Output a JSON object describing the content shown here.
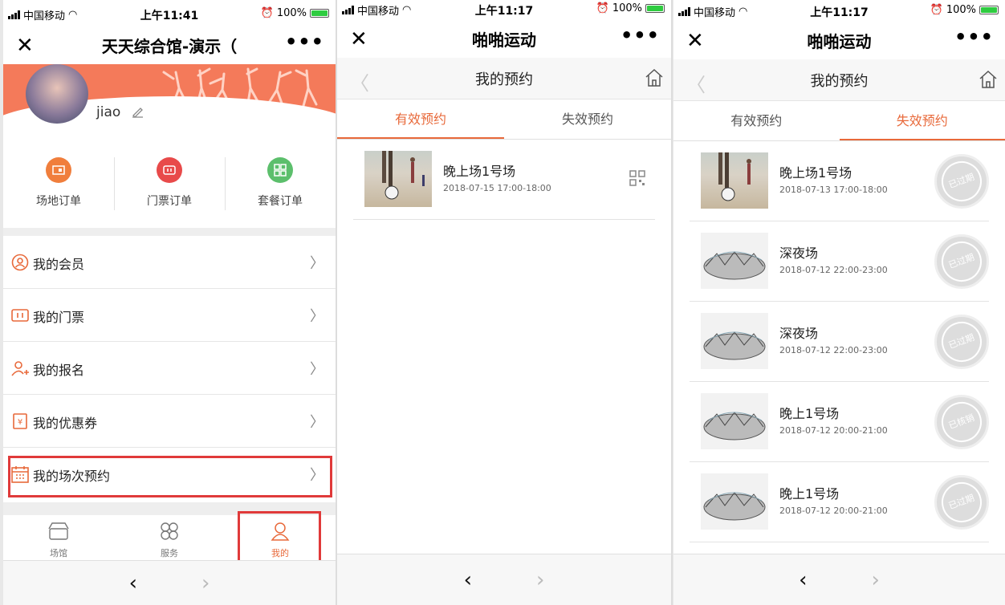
{
  "status_bars": [
    {
      "carrier": "中国移动",
      "time": "上午11:41",
      "battery": "100%"
    },
    {
      "carrier": "中国移动",
      "time": "上午11:17",
      "battery": "100%"
    },
    {
      "carrier": "中国移动",
      "time": "上午11:17",
      "battery": "100%"
    }
  ],
  "screen1": {
    "title": "天天综合馆-演示（",
    "close": "✕",
    "more": "•••",
    "username": "jiao",
    "quick_actions": [
      {
        "label": "场地订单",
        "icon": "venue-order-icon",
        "color": "#f07e3c"
      },
      {
        "label": "门票订单",
        "icon": "ticket-order-icon",
        "color": "#e84a4a"
      },
      {
        "label": "套餐订单",
        "icon": "package-order-icon",
        "color": "#5cbf6c"
      }
    ],
    "menu": [
      {
        "label": "我的会员",
        "icon": "member-icon"
      },
      {
        "label": "我的门票",
        "icon": "ticket-icon"
      },
      {
        "label": "我的报名",
        "icon": "signup-icon"
      },
      {
        "label": "我的优惠券",
        "icon": "coupon-icon"
      },
      {
        "label": "我的场次预约",
        "icon": "calendar-icon"
      }
    ],
    "tabbar": [
      {
        "label": "场馆",
        "icon": "venue-icon"
      },
      {
        "label": "服务",
        "icon": "service-icon"
      },
      {
        "label": "我的",
        "icon": "profile-icon"
      }
    ],
    "accent": "#e8693a",
    "highlight_color": "#e03a3a"
  },
  "screen2": {
    "title": "啪啪运动",
    "subtitle": "我的预约",
    "tabs": [
      "有效预约",
      "失效预约"
    ],
    "active_tab": 0,
    "items": [
      {
        "name": "晚上场1号场",
        "time": "2018-07-15 17:00-18:00",
        "image": "beach-soccer"
      }
    ]
  },
  "screen3": {
    "title": "啪啪运动",
    "subtitle": "我的预约",
    "tabs": [
      "有效预约",
      "失效预约"
    ],
    "active_tab": 1,
    "items": [
      {
        "name": "晚上场1号场",
        "time": "2018-07-13 17:00-18:00",
        "stamp": "已过期",
        "image": "beach-soccer"
      },
      {
        "name": "深夜场",
        "time": "2018-07-12 22:00-23:00",
        "stamp": "已过期",
        "image": "birds-nest"
      },
      {
        "name": "深夜场",
        "time": "2018-07-12 22:00-23:00",
        "stamp": "已过期",
        "image": "birds-nest"
      },
      {
        "name": "晚上1号场",
        "time": "2018-07-12 20:00-21:00",
        "stamp": "已核销",
        "image": "birds-nest"
      },
      {
        "name": "晚上1号场",
        "time": "2018-07-12 20:00-21:00",
        "stamp": "已过期",
        "image": "birds-nest"
      }
    ]
  },
  "bottom_nav": {
    "back": "‹",
    "forward": "›"
  }
}
